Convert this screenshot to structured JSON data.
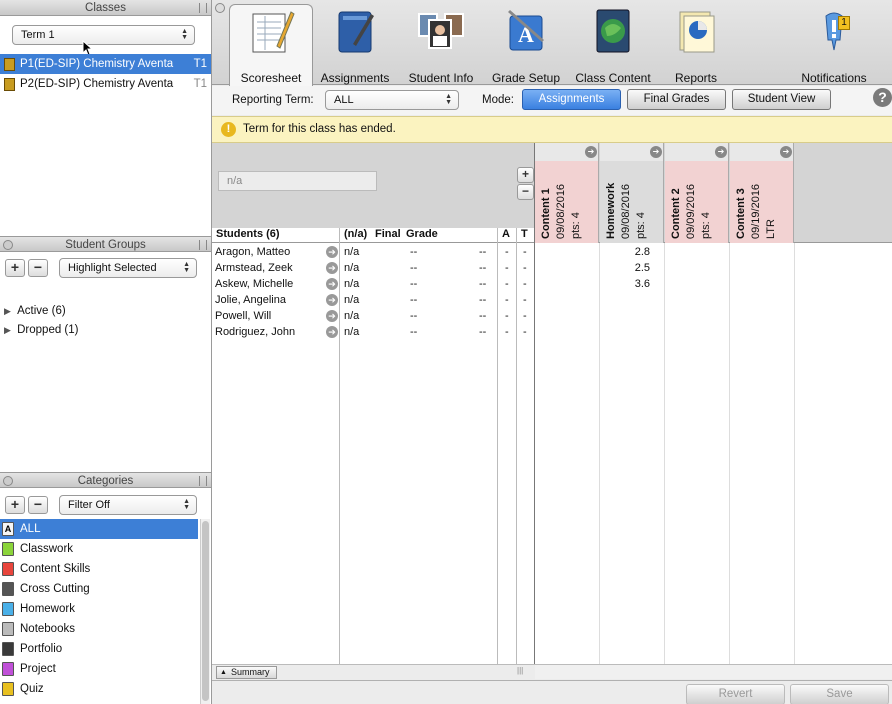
{
  "classes_panel": {
    "title": "Classes",
    "term_select": "Term 1",
    "rows": [
      {
        "name": "P1(ED-SIP) Chemistry  Aventa",
        "term": "T1",
        "selected": true
      },
      {
        "name": "P2(ED-SIP) Chemistry  Aventa",
        "term": "T1",
        "selected": false
      }
    ]
  },
  "groups_panel": {
    "title": "Student Groups",
    "add": "+",
    "remove": "−",
    "select": "Highlight Selected",
    "items": [
      {
        "label": "Active (6)"
      },
      {
        "label": "Dropped (1)"
      }
    ]
  },
  "categories_panel": {
    "title": "Categories",
    "add": "+",
    "remove": "−",
    "select": "Filter Off",
    "items": [
      {
        "label": "ALL",
        "color": "#f0f0f0",
        "selected": true
      },
      {
        "label": "Classwork",
        "color": "#8bd43a"
      },
      {
        "label": "Content Skills",
        "color": "#e8453c"
      },
      {
        "label": "Cross Cutting",
        "color": "#555555"
      },
      {
        "label": "Homework",
        "color": "#4ab0e8"
      },
      {
        "label": "Notebooks",
        "color": "#bbbbbb"
      },
      {
        "label": "Portfolio",
        "color": "#3a3a3a"
      },
      {
        "label": "Project",
        "color": "#c050d8"
      },
      {
        "label": "Quiz",
        "color": "#e8c020"
      }
    ]
  },
  "toolbar": {
    "items": [
      {
        "label": "Scoresheet",
        "icon": "scoresheet-icon"
      },
      {
        "label": "Assignments",
        "icon": "assignments-icon"
      },
      {
        "label": "Student Info",
        "icon": "student-info-icon"
      },
      {
        "label": "Grade Setup",
        "icon": "grade-setup-icon"
      },
      {
        "label": "Class Content",
        "icon": "class-content-icon"
      },
      {
        "label": "Reports",
        "icon": "reports-icon"
      },
      {
        "label": "Notifications",
        "icon": "notifications-icon"
      }
    ],
    "notification_count": "1"
  },
  "filter_bar": {
    "reporting_term_label": "Reporting Term:",
    "reporting_term_value": "ALL",
    "mode_label": "Mode:",
    "modes": [
      "Assignments",
      "Final Grades",
      "Student View"
    ],
    "help": "?"
  },
  "notice": "Term for this class has ended.",
  "grid": {
    "search_placeholder": "n/a",
    "headers": {
      "students": "Students (6)",
      "term": "(n/a)",
      "final": "Final",
      "grade": "Grade",
      "a": "A",
      "t": "T"
    },
    "students": [
      {
        "name": "Aragon, Matteo",
        "na": "n/a",
        "final": "--",
        "grade": "--",
        "a": "-",
        "t": "-"
      },
      {
        "name": "Armstead, Zeek",
        "na": "n/a",
        "final": "--",
        "grade": "--",
        "a": "-",
        "t": "-"
      },
      {
        "name": "Askew, Michelle",
        "na": "n/a",
        "final": "--",
        "grade": "--",
        "a": "-",
        "t": "-"
      },
      {
        "name": "Jolie, Angelina",
        "na": "n/a",
        "final": "--",
        "grade": "--",
        "a": "-",
        "t": "-"
      },
      {
        "name": "Powell, Will",
        "na": "n/a",
        "final": "--",
        "grade": "--",
        "a": "-",
        "t": "-"
      },
      {
        "name": "Rodriguez, John",
        "na": "n/a",
        "final": "--",
        "grade": "--",
        "a": "-",
        "t": "-"
      }
    ],
    "assignments": [
      {
        "name": "Content 1",
        "date": "09/08/2016",
        "pts": "pts: 4",
        "color": "#f2d2d2",
        "scores": [
          "",
          "",
          ""
        ]
      },
      {
        "name": "Homework",
        "date": "09/08/2016",
        "pts": "pts: 4",
        "color": "#dcdcdc",
        "scores": [
          "2.8",
          "2.5",
          "3.6"
        ]
      },
      {
        "name": "Content 2",
        "date": "09/09/2016",
        "pts": "pts: 4",
        "color": "#f2d2d2",
        "scores": [
          "",
          "",
          ""
        ]
      },
      {
        "name": "Content 3",
        "date": "09/19/2016",
        "pts": "LTR",
        "color": "#f2d2d2",
        "scores": [
          "",
          "",
          ""
        ]
      }
    ],
    "summary": "Summary"
  },
  "footer": {
    "revert": "Revert",
    "save": "Save"
  }
}
